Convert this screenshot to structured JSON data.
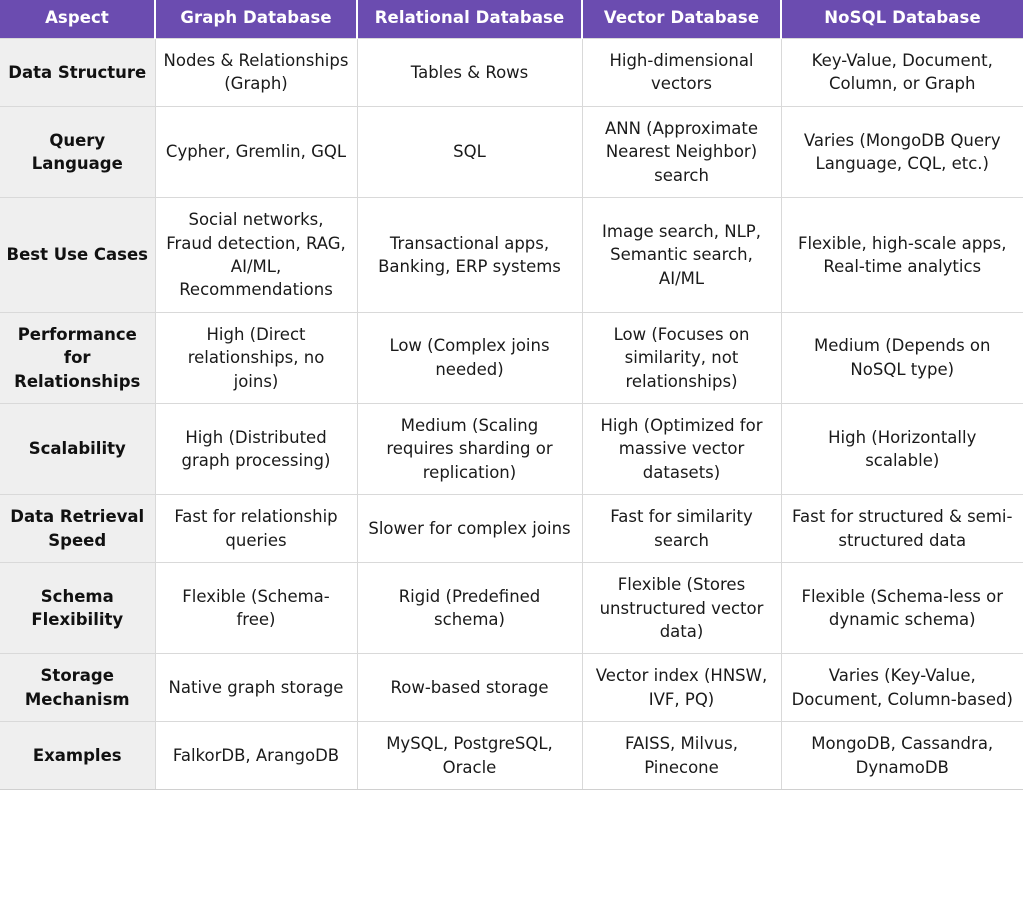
{
  "table": {
    "accent_color": "#6B4CB0",
    "aspect_column_bg": "#efefef",
    "border_color": "#d9d9d9",
    "headers": [
      "Aspect",
      "Graph Database",
      "Relational Database",
      "Vector Database",
      "NoSQL Database"
    ],
    "rows": [
      {
        "aspect": "Data Structure",
        "graph": "Nodes & Relationships (Graph)",
        "relational": "Tables & Rows",
        "vector": "High-dimensional vectors",
        "nosql": "Key-Value, Document, Column, or Graph"
      },
      {
        "aspect": "Query Language",
        "graph": "Cypher, Gremlin, GQL",
        "relational": "SQL",
        "vector": "ANN (Approximate Nearest Neighbor) search",
        "nosql": "Varies (MongoDB Query Language, CQL, etc.)"
      },
      {
        "aspect": "Best Use Cases",
        "graph": "Social networks, Fraud detection, RAG, AI/ML, Recommendations",
        "relational": "Transactional apps, Banking, ERP systems",
        "vector": "Image search, NLP, Semantic search, AI/ML",
        "nosql": "Flexible, high-scale apps, Real-time analytics"
      },
      {
        "aspect": "Performance for Relationships",
        "graph": "High (Direct relationships, no joins)",
        "relational": "Low (Complex joins needed)",
        "vector": "Low (Focuses on similarity, not relationships)",
        "nosql": "Medium (Depends on NoSQL type)"
      },
      {
        "aspect": "Scalability",
        "graph": "High (Distributed graph processing)",
        "relational": "Medium (Scaling requires sharding or replication)",
        "vector": "High (Optimized for massive vector datasets)",
        "nosql": "High (Horizontally scalable)"
      },
      {
        "aspect": "Data Retrieval Speed",
        "graph": "Fast for relationship queries",
        "relational": "Slower for complex joins",
        "vector": "Fast for similarity search",
        "nosql": "Fast for structured & semi-structured data"
      },
      {
        "aspect": "Schema Flexibility",
        "graph": "Flexible (Schema-free)",
        "relational": "Rigid (Predefined schema)",
        "vector": "Flexible (Stores unstructured vector data)",
        "nosql": "Flexible (Schema-less or dynamic schema)"
      },
      {
        "aspect": "Storage Mechanism",
        "graph": "Native graph storage",
        "relational": "Row-based storage",
        "vector": "Vector index (HNSW, IVF, PQ)",
        "nosql": "Varies (Key-Value, Document, Column-based)"
      },
      {
        "aspect": "Examples",
        "graph": "FalkorDB, ArangoDB",
        "relational": "MySQL, PostgreSQL, Oracle",
        "vector": "FAISS, Milvus, Pinecone",
        "nosql": "MongoDB, Cassandra, DynamoDB"
      }
    ]
  }
}
